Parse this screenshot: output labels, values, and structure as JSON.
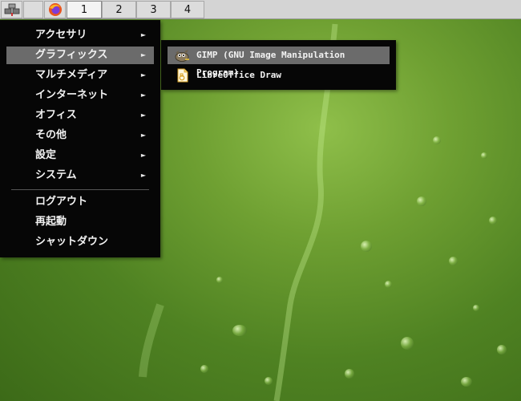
{
  "taskbar": {
    "workspaces": [
      "1",
      "2",
      "3",
      "4"
    ],
    "icons": [
      "network-icon",
      "window-icon",
      "firefox-icon"
    ]
  },
  "menu": {
    "items": [
      {
        "label": "アクセサリ",
        "has_submenu": true
      },
      {
        "label": "グラフィックス",
        "has_submenu": true
      },
      {
        "label": "マルチメディア",
        "has_submenu": true
      },
      {
        "label": "インターネット",
        "has_submenu": true
      },
      {
        "label": "オフィス",
        "has_submenu": true
      },
      {
        "label": "その他",
        "has_submenu": true
      },
      {
        "label": "設定",
        "has_submenu": true
      },
      {
        "label": "システム",
        "has_submenu": true
      }
    ],
    "actions": [
      {
        "label": "ログアウト"
      },
      {
        "label": "再起動"
      },
      {
        "label": "シャットダウン"
      }
    ],
    "arrow_glyph": "►"
  },
  "submenu": {
    "items": [
      {
        "label": "GIMP (GNU Image Manipulation Program)",
        "icon": "gimp-icon"
      },
      {
        "label": "LibreOffice Draw",
        "icon": "libreoffice-draw-icon"
      }
    ]
  },
  "colors": {
    "menu_bg": "#060606",
    "highlight": "#6b6b6b",
    "taskbar_bg": "#d4d4d4"
  }
}
